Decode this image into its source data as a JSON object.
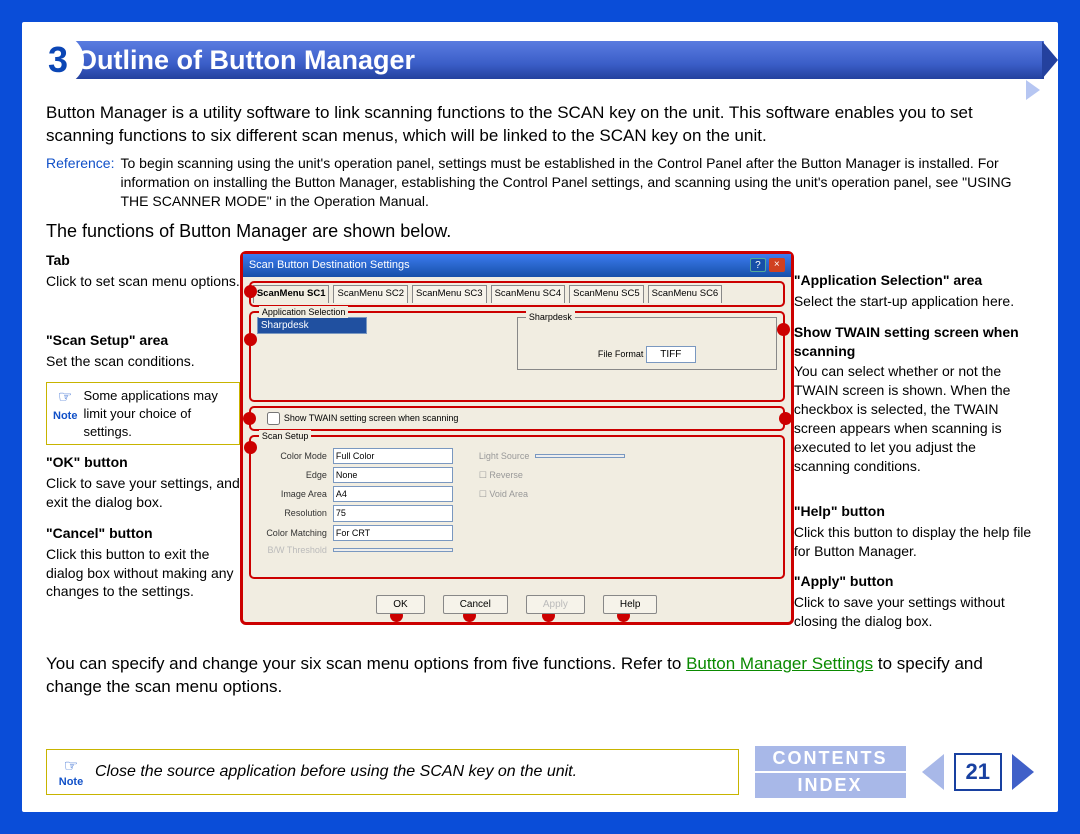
{
  "chapter": "3",
  "title": "Outline of Button Manager",
  "intro": "Button Manager is a utility software to link scanning functions to the SCAN key on the unit. This software enables you to set scanning functions to six different scan menus, which will be linked to the SCAN key on the unit.",
  "reference_label": "Reference:",
  "reference_text": "To begin scanning using the unit's operation panel, settings must be established in the Control Panel after the Button Manager is installed. For information on installing the Button Manager, establishing the Control Panel settings, and scanning using the unit's operation panel, see \"USING THE SCANNER MODE\" in the Operation Manual.",
  "subhead": "The functions of Button Manager are shown below.",
  "left": {
    "tab": {
      "title": "Tab",
      "text": "Click to set scan menu options."
    },
    "scan_setup": {
      "title": "\"Scan Setup\" area",
      "text": "Set the scan conditions."
    },
    "note": {
      "label": "Note",
      "text": "Some applications may limit your choice of settings."
    },
    "ok": {
      "title": "\"OK\" button",
      "text": "Click to save your settings, and exit the dialog box."
    },
    "cancel": {
      "title": "\"Cancel\" button",
      "text": "Click this button to exit the dialog box without making any changes to the settings."
    }
  },
  "right": {
    "appsel": {
      "title": "\"Application Selection\" area",
      "text": "Select the start-up application here."
    },
    "twain": {
      "title": "Show TWAIN setting screen when scanning",
      "text": "You can select whether or not the TWAIN screen is shown. When the checkbox is selected, the TWAIN screen appears when scanning is executed to let you adjust the scanning conditions."
    },
    "help": {
      "title": "\"Help\" button",
      "text": "Click this button to display the help file for Button Manager."
    },
    "apply": {
      "title": "\"Apply\" button",
      "text": "Click to save your settings without closing the dialog box."
    }
  },
  "win": {
    "title": "Scan Button Destination Settings",
    "tabs": [
      "ScanMenu SC1",
      "ScanMenu SC2",
      "ScanMenu SC3",
      "ScanMenu SC4",
      "ScanMenu SC5",
      "ScanMenu SC6"
    ],
    "appsel_label": "Application Selection",
    "app_value": "Sharpdesk",
    "sharpdesk": "Sharpdesk",
    "file_format_label": "File Format",
    "file_format_value": "TIFF",
    "twain_check": "Show TWAIN setting screen when scanning",
    "scan_setup_label": "Scan Setup",
    "color_mode_label": "Color Mode",
    "color_mode": "Full Color",
    "edge_label": "Edge",
    "edge": "None",
    "image_area_label": "Image Area",
    "image_area": "A4",
    "resolution_label": "Resolution",
    "resolution": "75",
    "color_match_label": "Color Matching",
    "color_match": "For CRT",
    "bw_label": "B/W Threshold",
    "light_source": "Light Source",
    "reverse": "Reverse",
    "void_area": "Void Area",
    "ok": "OK",
    "cancel": "Cancel",
    "apply": "Apply",
    "help": "Help"
  },
  "after_a": "You can specify and change your six scan menu options from five functions. Refer to ",
  "after_link": "Button Manager Settings",
  "after_b": " to specify and change the scan menu options.",
  "foot_note_label": "Note",
  "foot_note": "Close the source application before using the SCAN key on the unit.",
  "contents": "CONTENTS",
  "index": "INDEX",
  "page_num": "21"
}
